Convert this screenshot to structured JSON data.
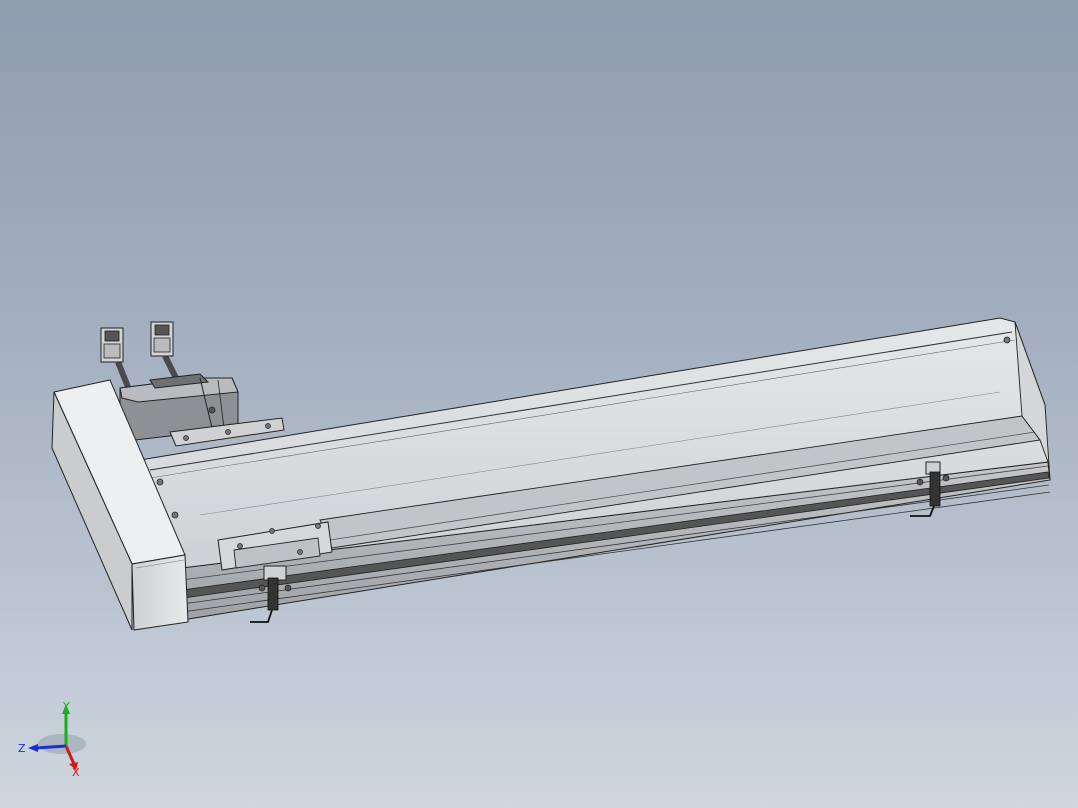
{
  "viewport": {
    "background_top": "#8f9db0",
    "background_bottom": "#cfd6df"
  },
  "model": {
    "subject": "linear-actuator-assembly",
    "parts": [
      "motor",
      "connector-cable-1",
      "connector-cable-2",
      "end-cap",
      "rail-body",
      "top-cover",
      "carriage-slider",
      "limit-sensor-1",
      "limit-sensor-2",
      "timing-belt"
    ],
    "colors": {
      "body": "#d9dadc",
      "shadow": "#9a9ca0",
      "edge": "#2a2a2a",
      "dark": "#3c3c3c"
    }
  },
  "triad": {
    "x_label": "X",
    "y_label": "Y",
    "z_label": "Z",
    "x_color": "#d01818",
    "y_color": "#18b018",
    "z_color": "#1a2fd0"
  }
}
